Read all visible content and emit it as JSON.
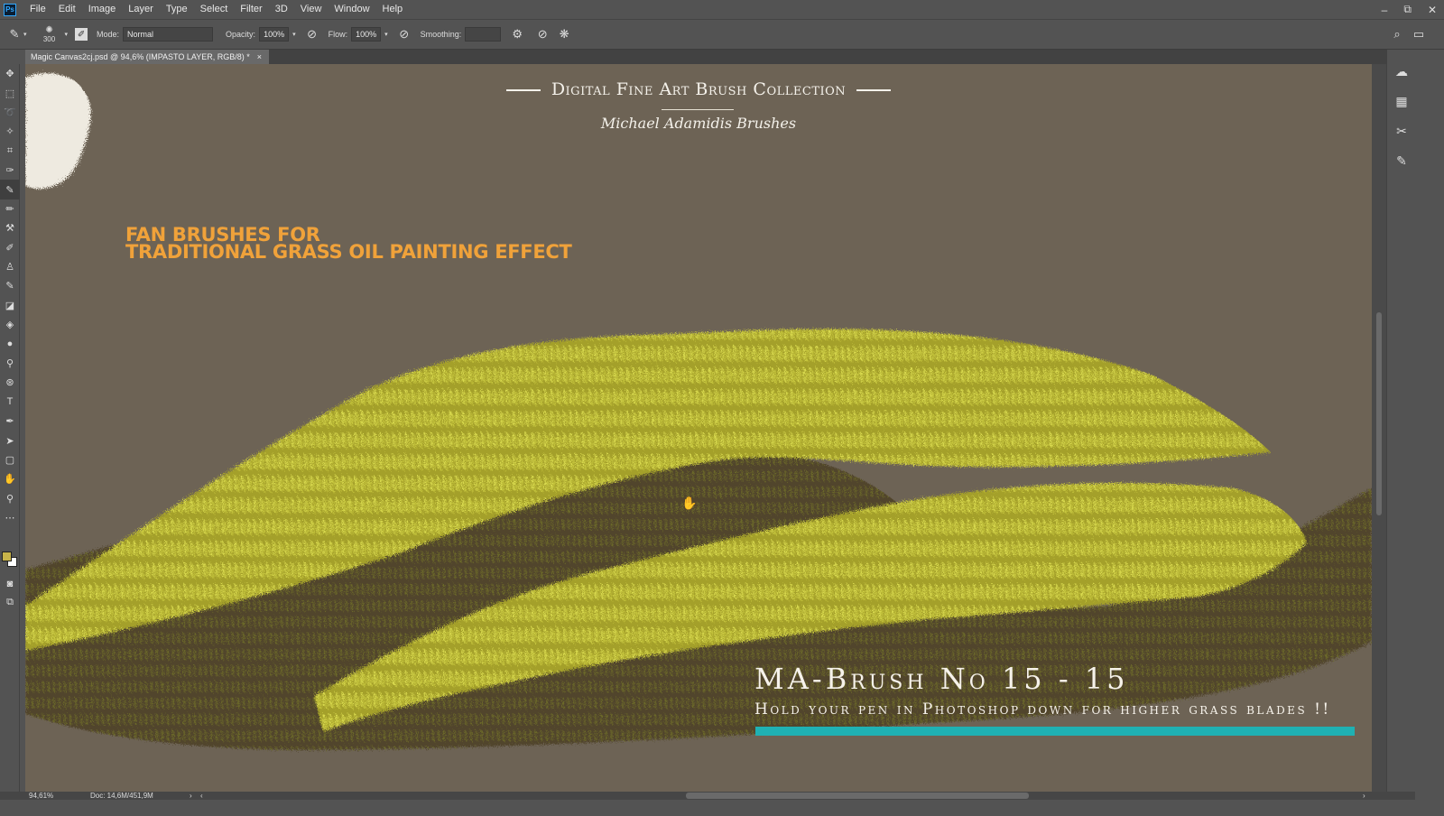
{
  "app": {
    "logo": "Ps"
  },
  "menu": [
    "File",
    "Edit",
    "Image",
    "Layer",
    "Type",
    "Select",
    "Filter",
    "3D",
    "View",
    "Window",
    "Help"
  ],
  "window_controls": {
    "minimize": "–",
    "restore": "⧉",
    "close": "✕"
  },
  "options_bar": {
    "brush_size": "300",
    "mode_label": "Mode:",
    "mode_value": "Normal",
    "opacity_label": "Opacity:",
    "opacity_value": "100%",
    "flow_label": "Flow:",
    "flow_value": "100%",
    "smoothing_label": "Smoothing:",
    "smoothing_value": ""
  },
  "document_tab": {
    "title": "Magic Canvas2cj.psd @ 94,6% (IMPASTO LAYER, RGB/8) *",
    "close": "×"
  },
  "colors": {
    "foreground": "#c8b44a",
    "background": "#ffffff",
    "canvas": "#6d6355",
    "accent_teal": "#1fb1b3",
    "orange_text": "#f0a23a"
  },
  "canvas": {
    "header_title": "Digital Fine Art Brush Collection",
    "header_subtitle": "Michael Adamidis Brushes",
    "headline_line1": "FAN BRUSHES FOR",
    "headline_line2": "TRADITIONAL GRASS OIL PAINTING EFFECT",
    "brush_name": "MA-Brush No 15 - 15",
    "instruction": "Hold your pen in Photoshop down for higher grass blades !!"
  },
  "status_bar": {
    "zoom": "94,61%",
    "doc_size": "Doc: 14,6M/451,9M"
  },
  "tools": [
    "move-icon",
    "marquee-icon",
    "lasso-icon",
    "magic-wand-icon",
    "crop-icon",
    "eyedropper-icon",
    "healing-brush-icon",
    "brush-icon",
    "clone-stamp-icon",
    "history-brush-icon",
    "eraser-icon",
    "paint-bucket-icon",
    "blur-icon",
    "dodge-icon",
    "pen-icon",
    "type-icon",
    "path-selection-icon",
    "rectangle-icon",
    "hand-icon",
    "zoom-icon",
    "more-tools-icon"
  ],
  "right_panel_icons": [
    "cloud-icon",
    "grid-icon",
    "tools-icon",
    "brush-settings-icon"
  ]
}
